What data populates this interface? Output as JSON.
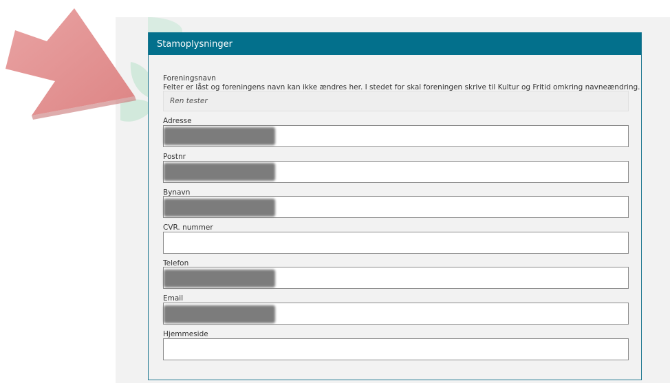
{
  "panel": {
    "title": "Stamoplysninger",
    "header_color": "#03708c"
  },
  "fields": {
    "foreningsnavn": {
      "label": "Foreningsnavn",
      "help": "Felter er låst og foreningens navn kan ikke ændres her. I stedet for skal foreningen skrive til Kultur og Fritid omkring navneændring.",
      "value": "Ren tester"
    },
    "adresse": {
      "label": "Adresse",
      "value": "",
      "redacted": true
    },
    "postnr": {
      "label": "Postnr",
      "value": "",
      "redacted": true
    },
    "bynavn": {
      "label": "Bynavn",
      "value": "",
      "redacted": true
    },
    "cvr": {
      "label": "CVR. nummer",
      "value": ""
    },
    "telefon": {
      "label": "Telefon",
      "value": "",
      "redacted": true
    },
    "email": {
      "label": "Email",
      "value": "",
      "redacted": true
    },
    "hjemmeside": {
      "label": "Hjemmeside",
      "value": ""
    }
  },
  "annotation": {
    "arrow_color": "#e08a8a",
    "arrow_icon": "pointing-arrow-icon"
  }
}
